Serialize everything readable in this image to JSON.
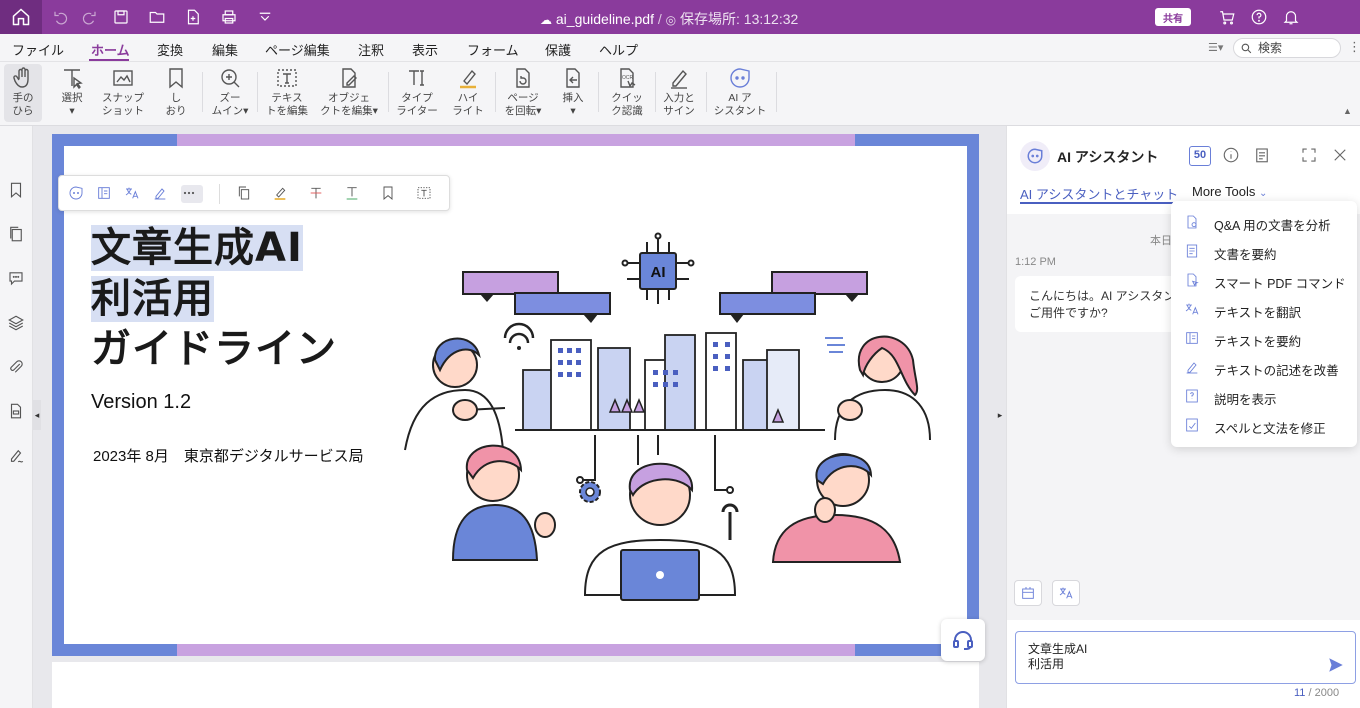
{
  "titlebar": {
    "file_name": "ai_guideline.pdf",
    "separator": "/",
    "save_status": "保存場所: 13:12:32",
    "share_label": "共有"
  },
  "menu": {
    "items": [
      "ファイル",
      "ホーム",
      "変換",
      "編集",
      "ページ編集",
      "注釈",
      "表示",
      "フォーム",
      "保護",
      "ヘルプ"
    ],
    "active": "ホーム",
    "search_placeholder": "検索"
  },
  "ribbon": {
    "items": [
      {
        "label": "手の\nひら",
        "icon": "hand-icon"
      },
      {
        "label": "選択\n▾",
        "icon": "select-cursor-icon"
      },
      {
        "label": "スナップ\nショット",
        "icon": "snapshot-icon"
      },
      {
        "label": "し\nおり",
        "icon": "bookmark-icon"
      },
      {
        "label": "ズー\nムイン▾",
        "icon": "zoom-in-icon"
      },
      {
        "label": "テキス\nトを編集",
        "icon": "edit-text-icon"
      },
      {
        "label": "オブジェ\nクトを編集▾",
        "icon": "edit-object-icon"
      },
      {
        "label": "タイプ\nライター",
        "icon": "typewriter-icon"
      },
      {
        "label": "ハイ\nライト",
        "icon": "highlight-icon"
      },
      {
        "label": "ページ\nを回転▾",
        "icon": "rotate-page-icon"
      },
      {
        "label": "挿入\n▾",
        "icon": "insert-icon"
      },
      {
        "label": "クイッ\nク認識",
        "icon": "ocr-icon"
      },
      {
        "label": "入力と\nサイン",
        "icon": "fill-sign-icon"
      },
      {
        "label": "AI ア\nシスタント",
        "icon": "ai-assistant-icon"
      }
    ]
  },
  "document": {
    "title_line1": "文章生成AI",
    "title_line2": "利活用",
    "title_line3": "ガイドライン",
    "version": "Version 1.2",
    "date_org": "2023年 8月　東京都デジタルサービス局",
    "chip_label": "AI"
  },
  "ai_panel": {
    "title": "AI アシスタント",
    "token_count": "50",
    "tab_chat": "AI アシスタントとチャット",
    "tab_more": "More Tools",
    "today_label": "本日",
    "message_time": "1:12 PM",
    "message_line1": "こんにちは。AI アシスタントです。",
    "message_line2": "ご用件ですか?",
    "more_tools": [
      {
        "label": "Q&A 用の文書を分析",
        "icon": "qa-doc-icon"
      },
      {
        "label": "文書を要約",
        "icon": "summary-doc-icon"
      },
      {
        "label": "スマート PDF コマンド",
        "icon": "smart-command-icon"
      },
      {
        "label": "テキストを翻訳",
        "icon": "translate-icon"
      },
      {
        "label": "テキストを要約",
        "icon": "text-summary-icon"
      },
      {
        "label": "テキストの記述を改善",
        "icon": "improve-writing-icon"
      },
      {
        "label": "説明を表示",
        "icon": "explain-icon"
      },
      {
        "label": "スペルと文法を修正",
        "icon": "grammar-icon"
      }
    ],
    "input_value": "文章生成AI\n利活用",
    "char_count_current": "11",
    "char_count_max": " / 2000"
  },
  "colors": {
    "titlebar": "#8a3b9c",
    "accent": "#4a5fc0",
    "page_border": "#6a86d8",
    "page_band": "#c8a2e0"
  }
}
